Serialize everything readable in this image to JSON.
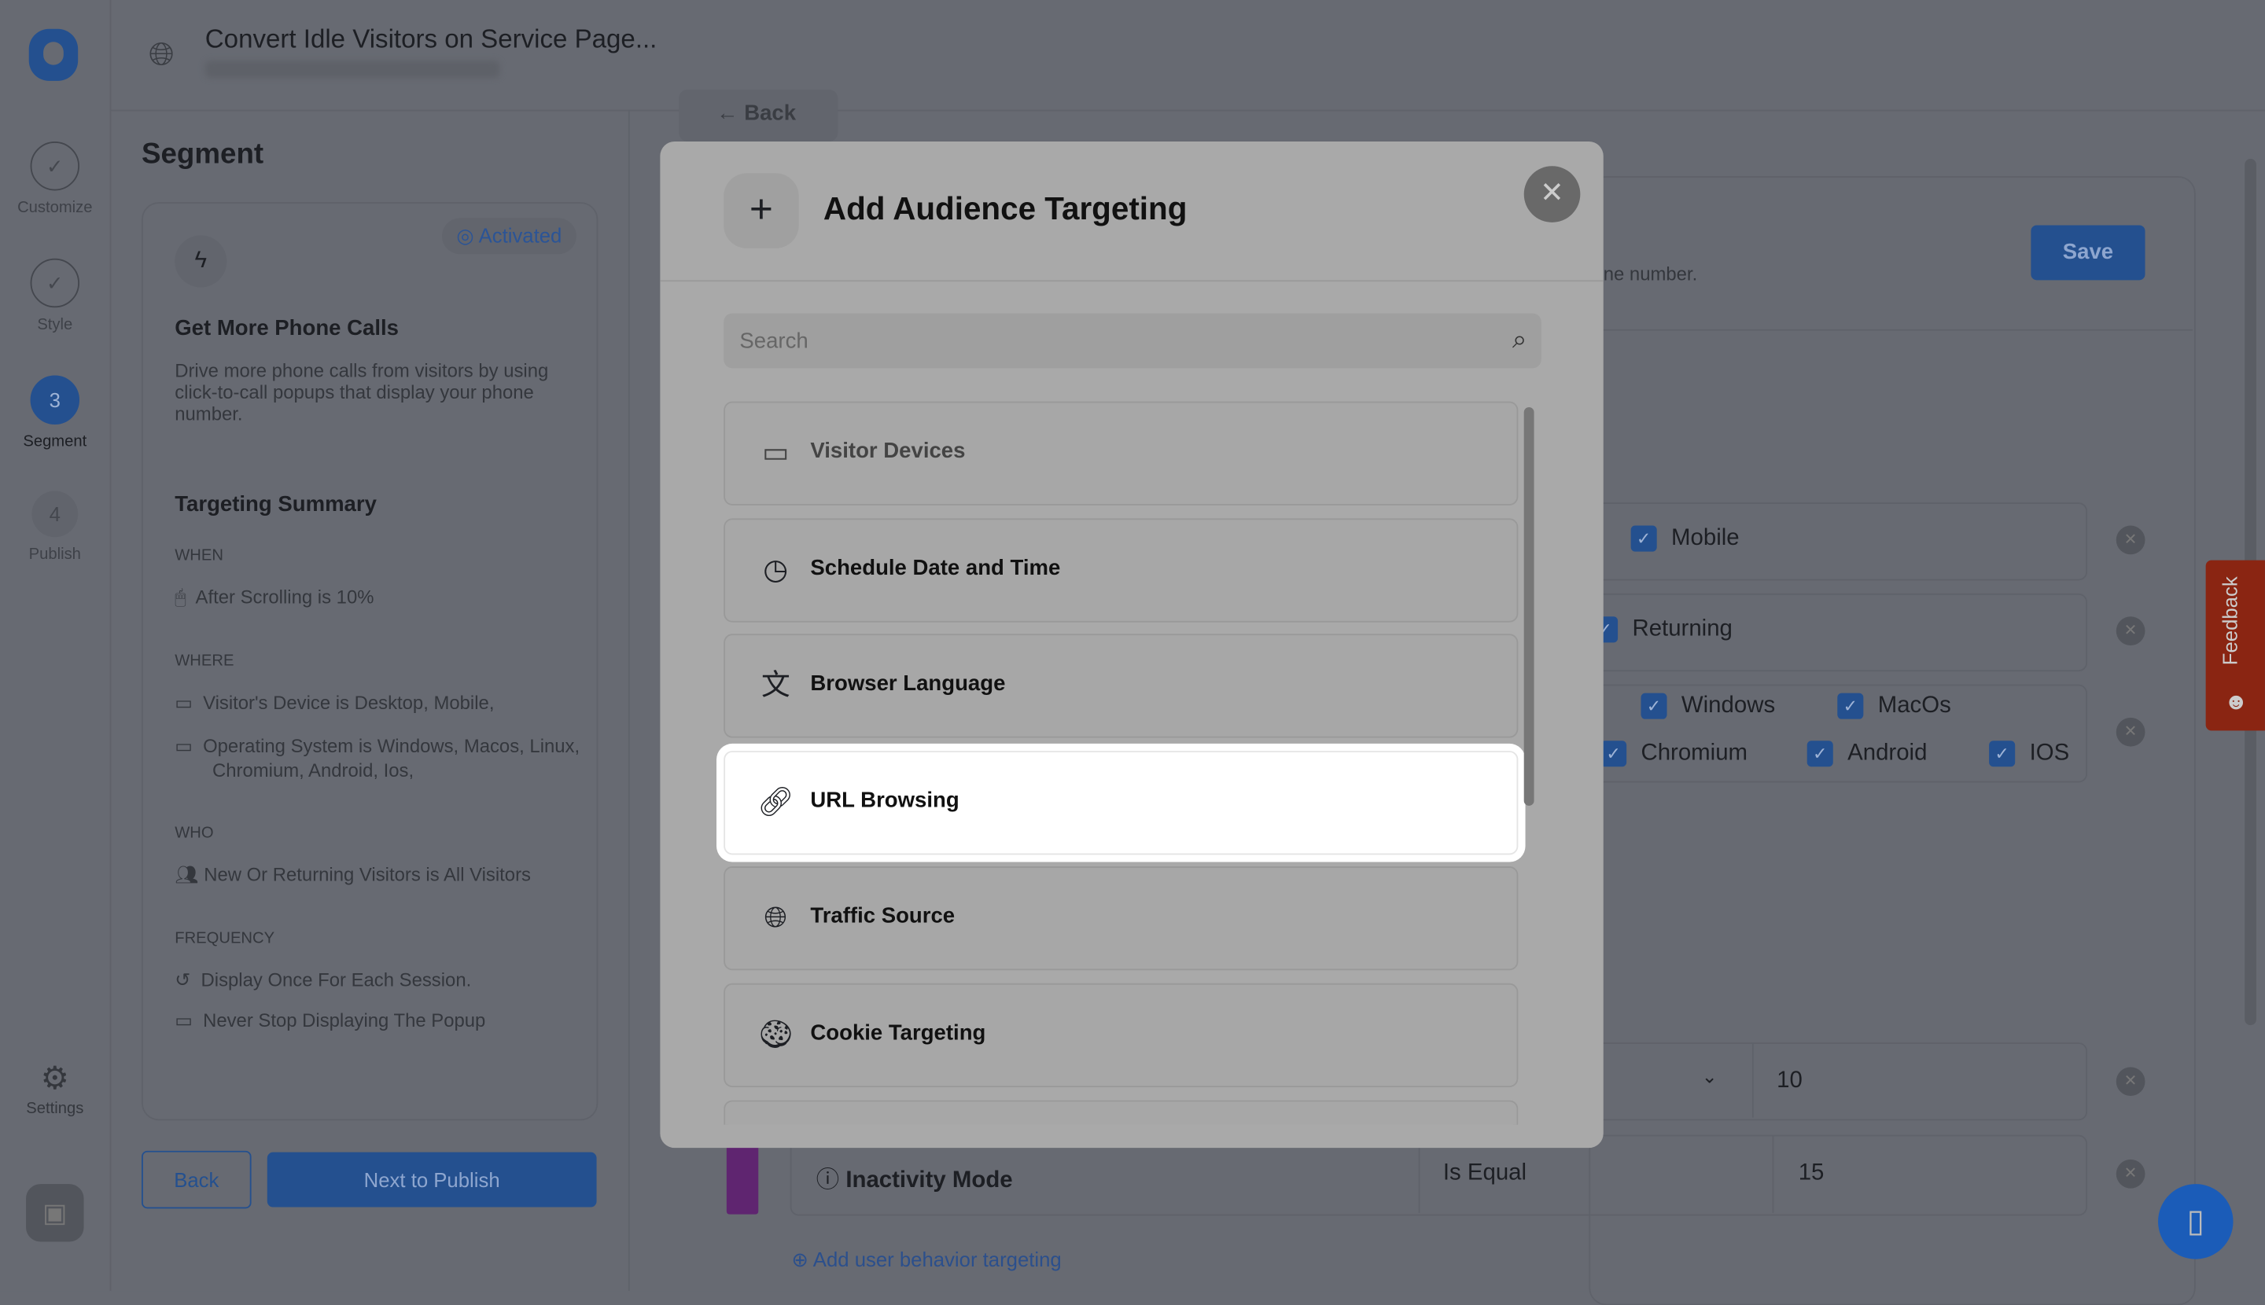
{
  "header": {
    "title": "Convert Idle Visitors on Service Page..."
  },
  "rail": {
    "steps": [
      {
        "n": "✓",
        "label": "Customize"
      },
      {
        "n": "✓",
        "label": "Style"
      },
      {
        "n": "3",
        "label": "Segment"
      },
      {
        "n": "4",
        "label": "Publish"
      }
    ],
    "settings": "Settings"
  },
  "segment": {
    "title": "Segment",
    "badge": "Activated",
    "card_title": "Get More Phone Calls",
    "card_desc": "Drive more phone calls from visitors by using click-to-call popups that display your phone number.",
    "summary_title": "Targeting Summary",
    "when_label": "WHEN",
    "when": [
      "After Scrolling is 10%"
    ],
    "where_label": "WHERE",
    "where": [
      "Visitor's Device is Desktop, Mobile,",
      "Operating System is Windows, Macos, Linux, Chromium, Android, Ios,"
    ],
    "who_label": "WHO",
    "who": [
      "New Or Returning Visitors is All Visitors"
    ],
    "freq_label": "FREQUENCY",
    "freq": [
      "Display Once For Each Session.",
      "Never Stop Displaying The Popup"
    ],
    "back": "Back",
    "next": "Next to Publish"
  },
  "main": {
    "back": "Back",
    "save": "Save",
    "desc_fragment": "ne number.",
    "mobile": "Mobile",
    "returning": "Returning",
    "os": [
      "Windows",
      "MacOs",
      "Chromium",
      "Android",
      "IOS"
    ],
    "scroll_value": "10",
    "inactivity": "Inactivity Mode",
    "inactivity_op": "Is Equal",
    "inactivity_value": "15",
    "add_behavior": "Add user behavior targeting"
  },
  "modal": {
    "title": "Add Audience Targeting",
    "search_placeholder": "Search",
    "items": [
      {
        "label": "Visitor Devices",
        "icon": "devices-icon"
      },
      {
        "label": "Schedule Date and Time",
        "icon": "clock-icon"
      },
      {
        "label": "Browser Language",
        "icon": "translate-icon"
      },
      {
        "label": "URL Browsing",
        "icon": "link-icon"
      },
      {
        "label": "Traffic Source",
        "icon": "globe-search-icon"
      },
      {
        "label": "Cookie Targeting",
        "icon": "cookie-icon"
      }
    ]
  },
  "feedback": "Feedback",
  "colors": {
    "accent": "#2b62c4",
    "feedback": "#8a2512",
    "overlay": "#676a72"
  }
}
